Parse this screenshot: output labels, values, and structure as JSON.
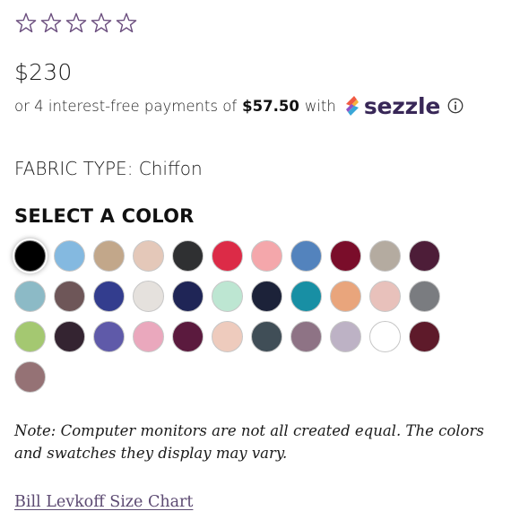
{
  "rating": {
    "star_count": 5,
    "filled": 0,
    "star_color": "#6b4e7e",
    "icon": "star-outline-icon"
  },
  "price": "$230",
  "installments": {
    "prefix": "or 4 interest-free payments of",
    "amount": "$57.50",
    "with": "with",
    "provider": "sezzle",
    "info_icon": "info-circle-icon"
  },
  "fabric": {
    "text": "FABRIC TYPE: Chiffon"
  },
  "colors": {
    "heading": "SELECT A COLOR",
    "selected_index": 0,
    "swatches": [
      "#000000",
      "#84b9e0",
      "#c2a78a",
      "#e4c8b9",
      "#2f3032",
      "#dc2b47",
      "#f4a7ab",
      "#5383bd",
      "#7a0d2a",
      "#b4aba0",
      "#4d1d38",
      "#8cbac6",
      "#6e5658",
      "#333d8e",
      "#e5e1dd",
      "#1f2556",
      "#bde6d2",
      "#1c2239",
      "#188fa4",
      "#e9a57c",
      "#e8c1bb",
      "#7a7c80",
      "#a4c871",
      "#342431",
      "#5f5aa9",
      "#eaa8bd",
      "#5b1a3e",
      "#eecbbd",
      "#404e57",
      "#8e7385",
      "#bdb2c5",
      "#ffffff",
      "#5e1a2a",
      "#957275"
    ]
  },
  "note": "Note: Computer monitors are not all created equal. The colors and swatches they display may vary.",
  "size_chart_link": "Bill Levkoff Size Chart"
}
